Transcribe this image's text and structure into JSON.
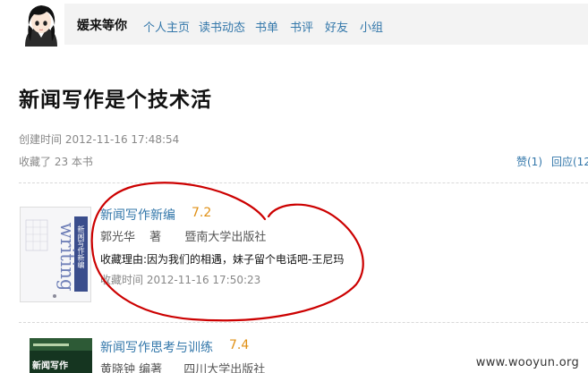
{
  "header": {
    "username": "媛来等你",
    "nav": [
      "个人主页",
      "读书动态",
      "书单",
      "书评",
      "好友",
      "小组"
    ]
  },
  "doulist": {
    "title": "新闻写作是个技术活",
    "created_label": "创建时间",
    "created_time": "2012-11-16 17:48:54",
    "count_text": "收藏了 23 本书",
    "like_text": "赞(1)",
    "reply_text": "回应(12"
  },
  "books": [
    {
      "title": "新闻写作新编",
      "rating": "7.2",
      "author": "郭光华",
      "role": "著",
      "publisher": "暨南大学出版社",
      "reason": "收藏理由:因为我们的相遇，妹子留个电话吧-王尼玛",
      "added_label": "收藏时间",
      "added_time": "2012-11-16 17:50:23",
      "cover_text": [
        "新闻写作新编",
        "writing"
      ]
    },
    {
      "title": "新闻写作思考与训练",
      "rating": "7.4",
      "author": "黄晓钟 编著",
      "publisher": "四川大学出版社",
      "cover_text": [
        "新闻写作"
      ]
    }
  ],
  "watermark": "www.wooyun.org",
  "colors": {
    "link": "#3377aa",
    "rating": "#e09015",
    "annotation": "#cc0000",
    "nav_band": "#f3f3f3"
  }
}
